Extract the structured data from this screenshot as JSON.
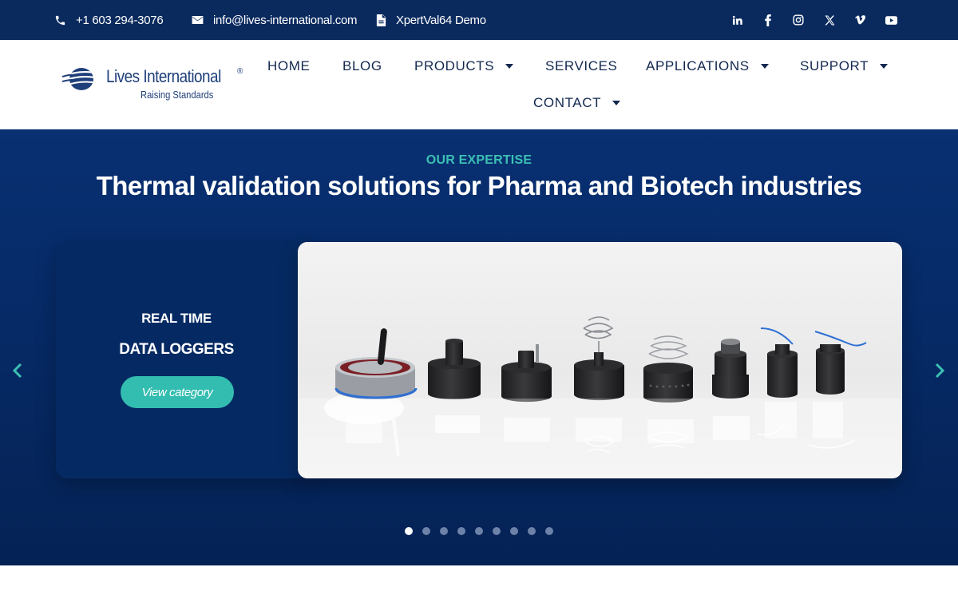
{
  "topbar": {
    "phone": "+1 603 294-3076",
    "email": "info@lives-international.com",
    "demo": "XpertVal64 Demo",
    "social_icons": [
      "linkedin-icon",
      "facebook-icon",
      "instagram-icon",
      "x-icon",
      "vimeo-icon",
      "youtube-icon"
    ],
    "social_labels": [
      "in",
      "f",
      "",
      "𝕏",
      "v",
      ""
    ]
  },
  "logo": {
    "name": "Lives International",
    "registered": "®",
    "tagline": "Raising Standards"
  },
  "nav": {
    "home": "HOME",
    "blog": "BLOG",
    "products": "PRODUCTS",
    "services": "SERVICES",
    "applications": "APPLICATIONS",
    "support": "SUPPORT",
    "contact": "CONTACT"
  },
  "hero": {
    "eyebrow": "OUR EXPERTISE",
    "title": "Thermal validation solutions for Pharma and Biotech industries",
    "slide": {
      "kicker": "REAL TIME",
      "category": "DATA LOGGERS",
      "button": "View category"
    },
    "slide_count": 9,
    "active_slide": 1
  },
  "colors": {
    "topbar_bg": "#0a2a5e",
    "hero_bg": "#062a66",
    "accent_teal": "#33bdb0",
    "nav_text": "#13284f"
  }
}
